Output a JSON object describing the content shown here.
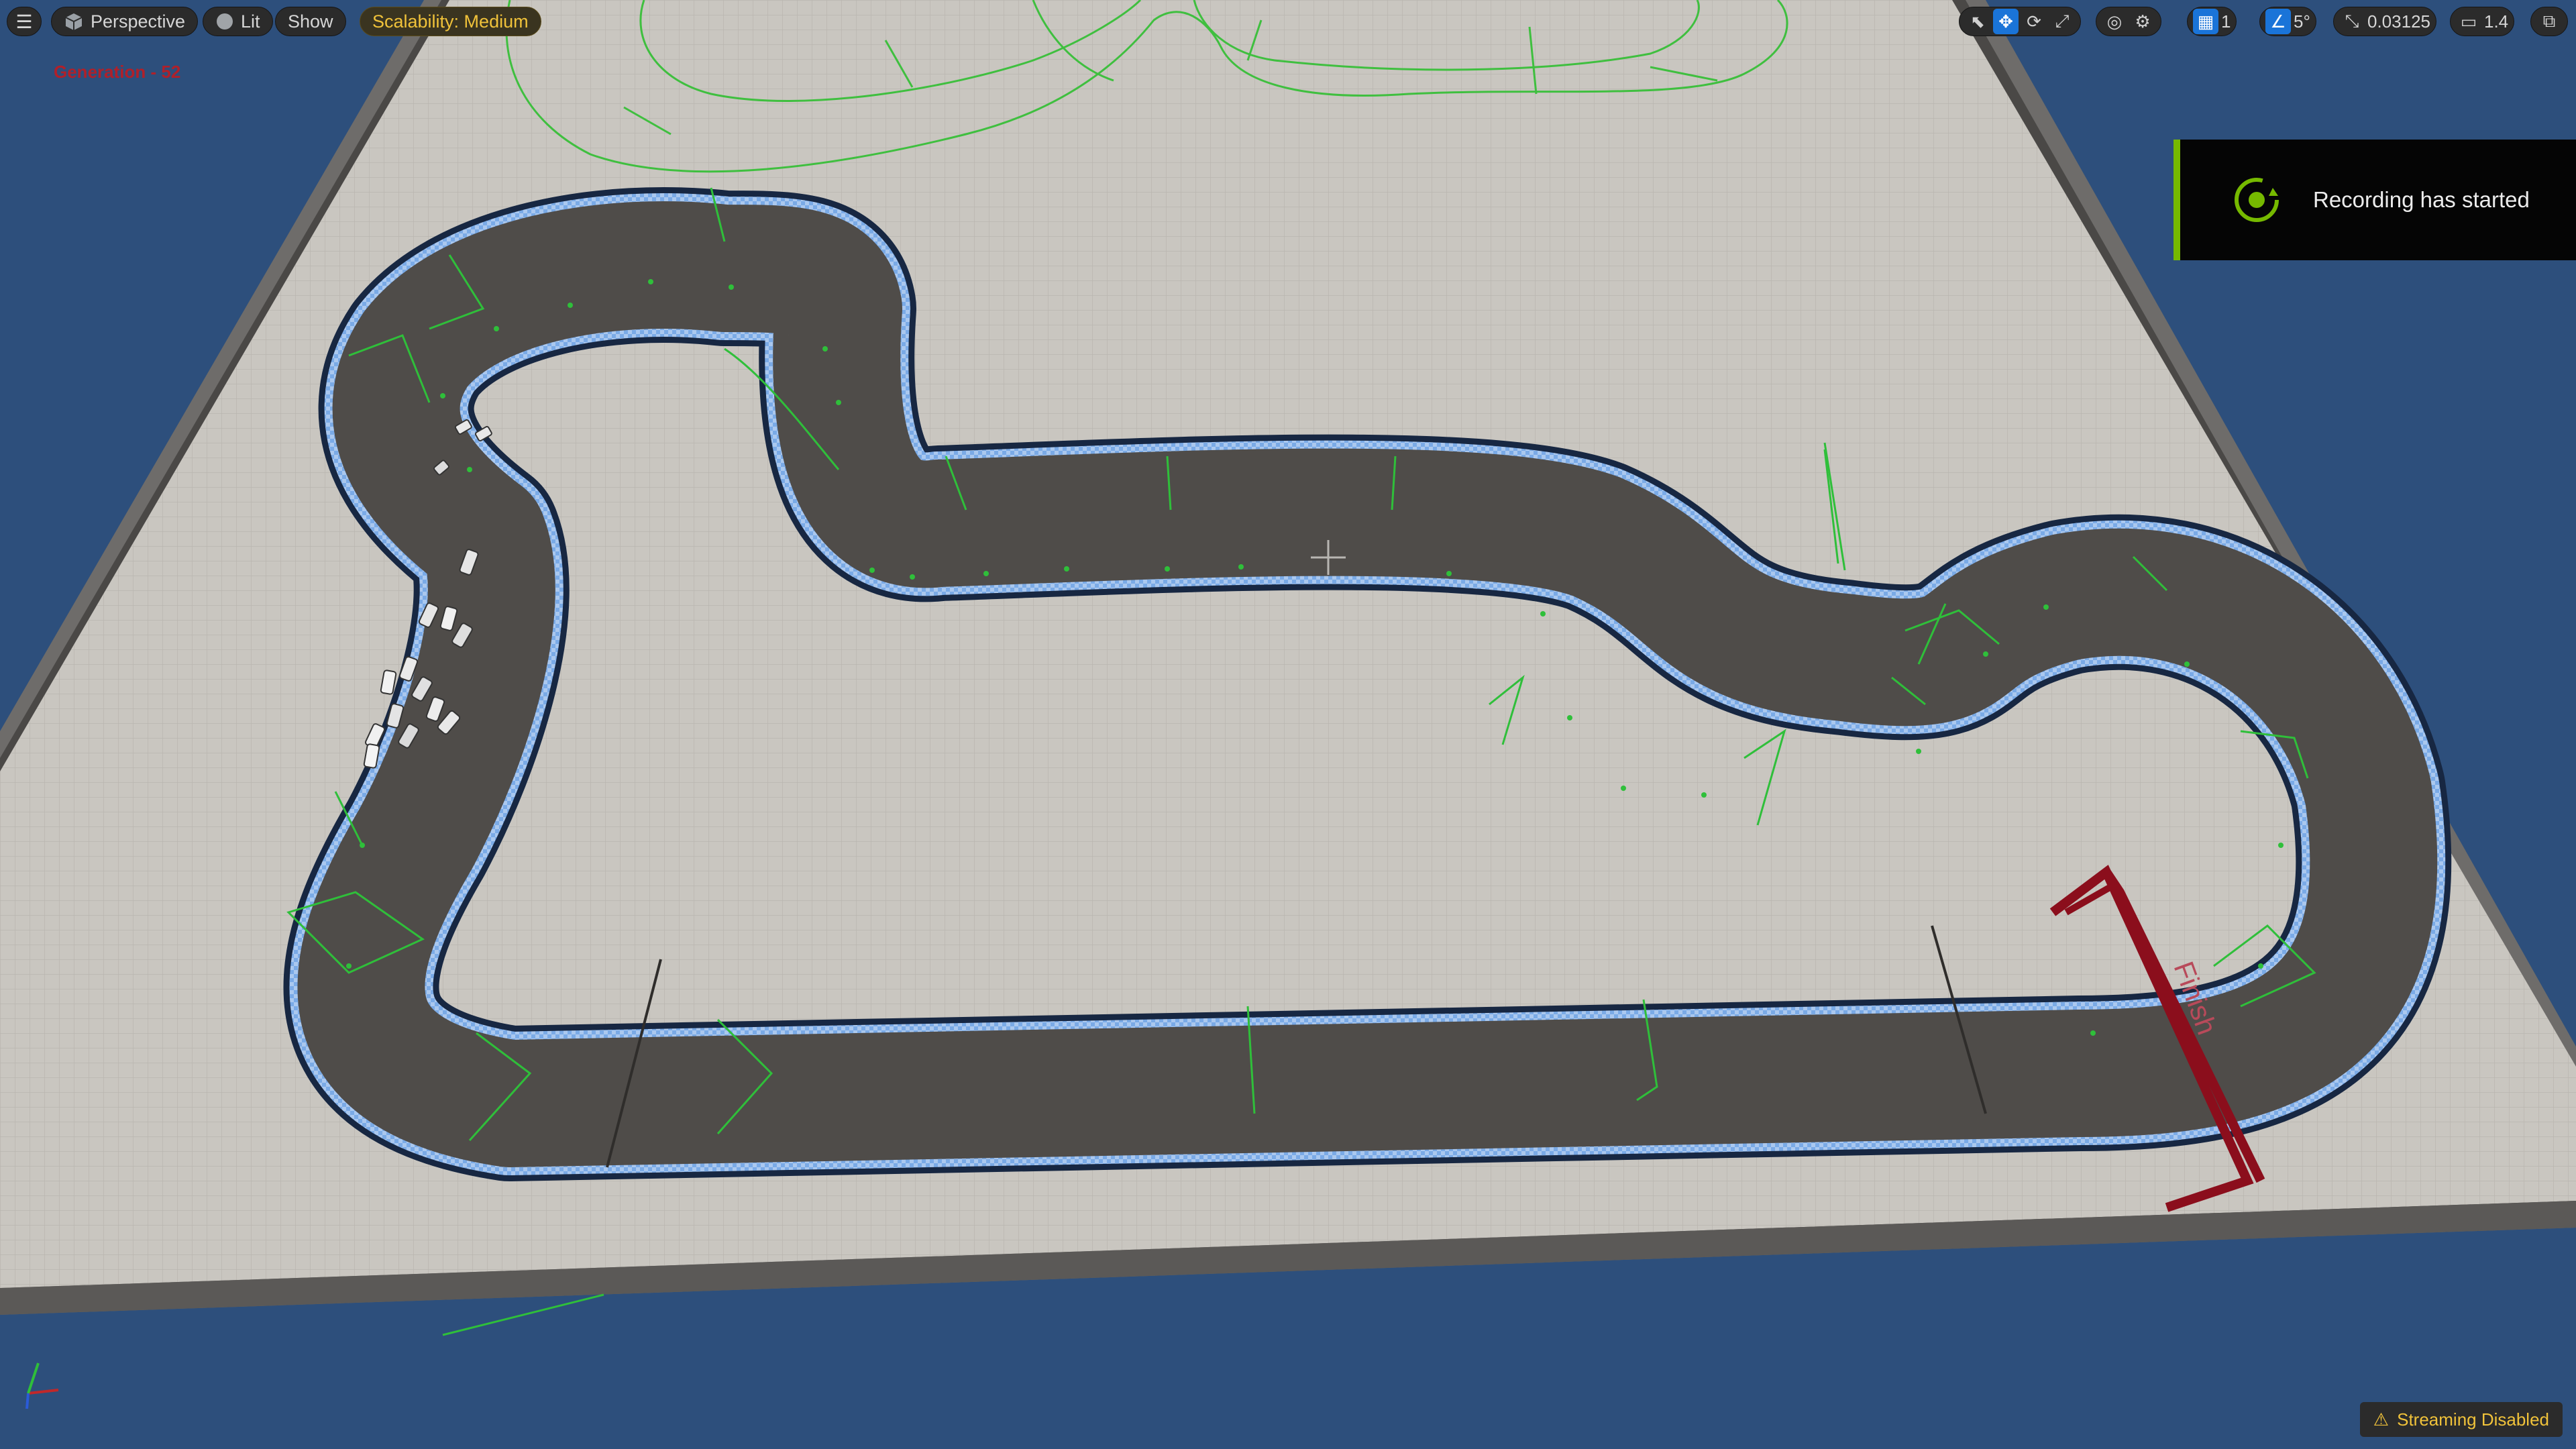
{
  "toolbar": {
    "menu_icon": "hamburger-icon",
    "perspective_label": "Perspective",
    "lit_label": "Lit",
    "show_label": "Show",
    "scalability_label": "Scalability: Medium",
    "grid_snap_value": "1",
    "rotation_snap_value": "5°",
    "scale_snap_value": "0.03125",
    "camera_speed_value": "1.4"
  },
  "overlay": {
    "generation_label": "Generation - 52",
    "recording_label": "Recording has started",
    "streaming_label": "Streaming Disabled",
    "finish_text": "Finish"
  },
  "colors": {
    "background": "#2d4f7c",
    "accent_blue": "#1a74d8",
    "scalability_text": "#f0c23a",
    "generation_text": "#b0202a",
    "nvidia_green": "#76b900",
    "finish_gate": "#8b0e1c",
    "checkpoint_lines": "#2fbf3a"
  }
}
